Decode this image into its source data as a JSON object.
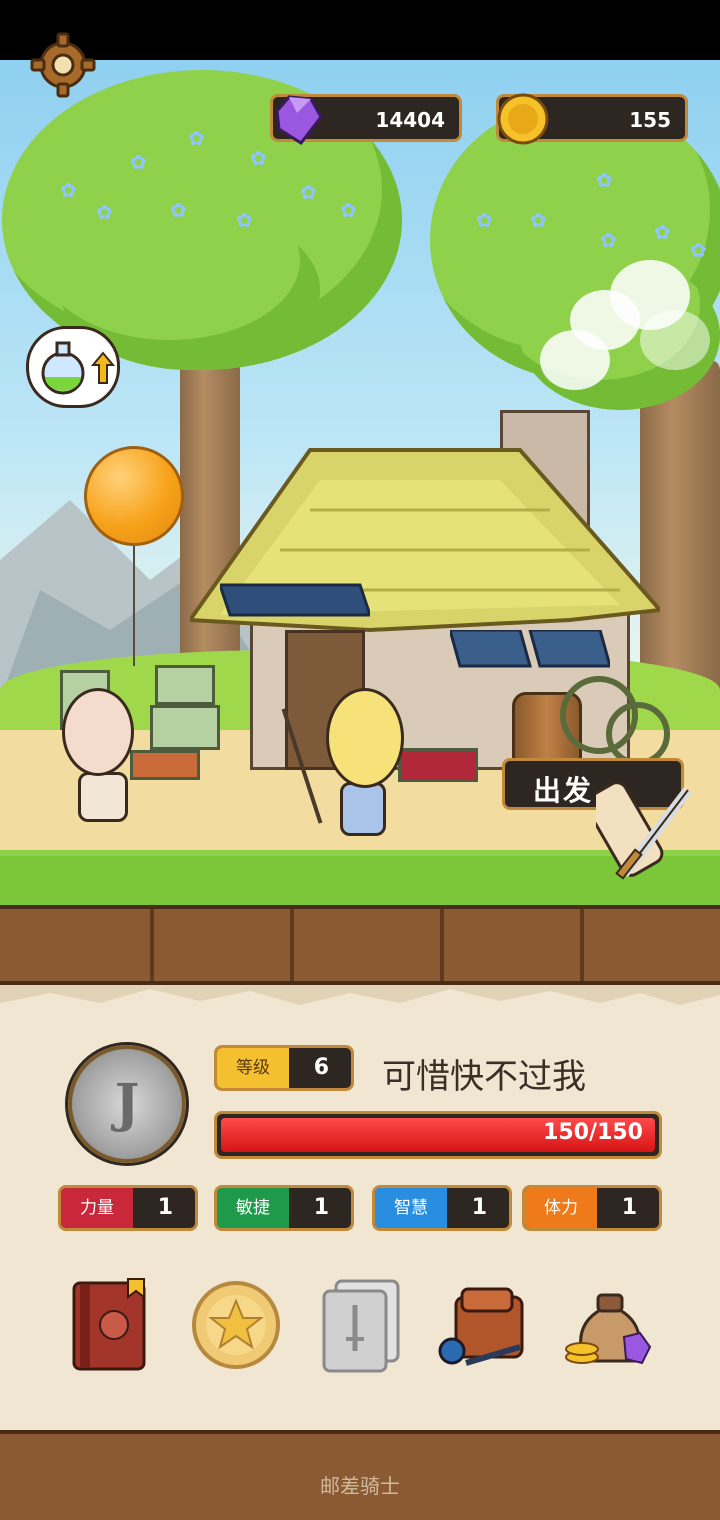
{
  "resources": {
    "gems": "14404",
    "coins": "155"
  },
  "actions": {
    "depart_label": "出发"
  },
  "player": {
    "medal_letter": "J",
    "level_label": "等级",
    "level": "6",
    "name": "可惜快不过我",
    "hp_text": "150/150",
    "hp_fraction": 1.0
  },
  "attributes": [
    {
      "label": "力量",
      "value": "1",
      "color": "#c8283a"
    },
    {
      "label": "敏捷",
      "value": "1",
      "color": "#1f9a4a"
    },
    {
      "label": "智慧",
      "value": "1",
      "color": "#2a8ee0"
    },
    {
      "label": "体力",
      "value": "1",
      "color": "#ee7a1a"
    }
  ],
  "menu": [
    {
      "icon": "hero-book-icon"
    },
    {
      "icon": "star-coin-icon"
    },
    {
      "icon": "skill-cards-icon"
    },
    {
      "icon": "inventory-bag-icon"
    },
    {
      "icon": "loot-sack-icon"
    }
  ],
  "footer": {
    "title": "邮差骑士"
  }
}
